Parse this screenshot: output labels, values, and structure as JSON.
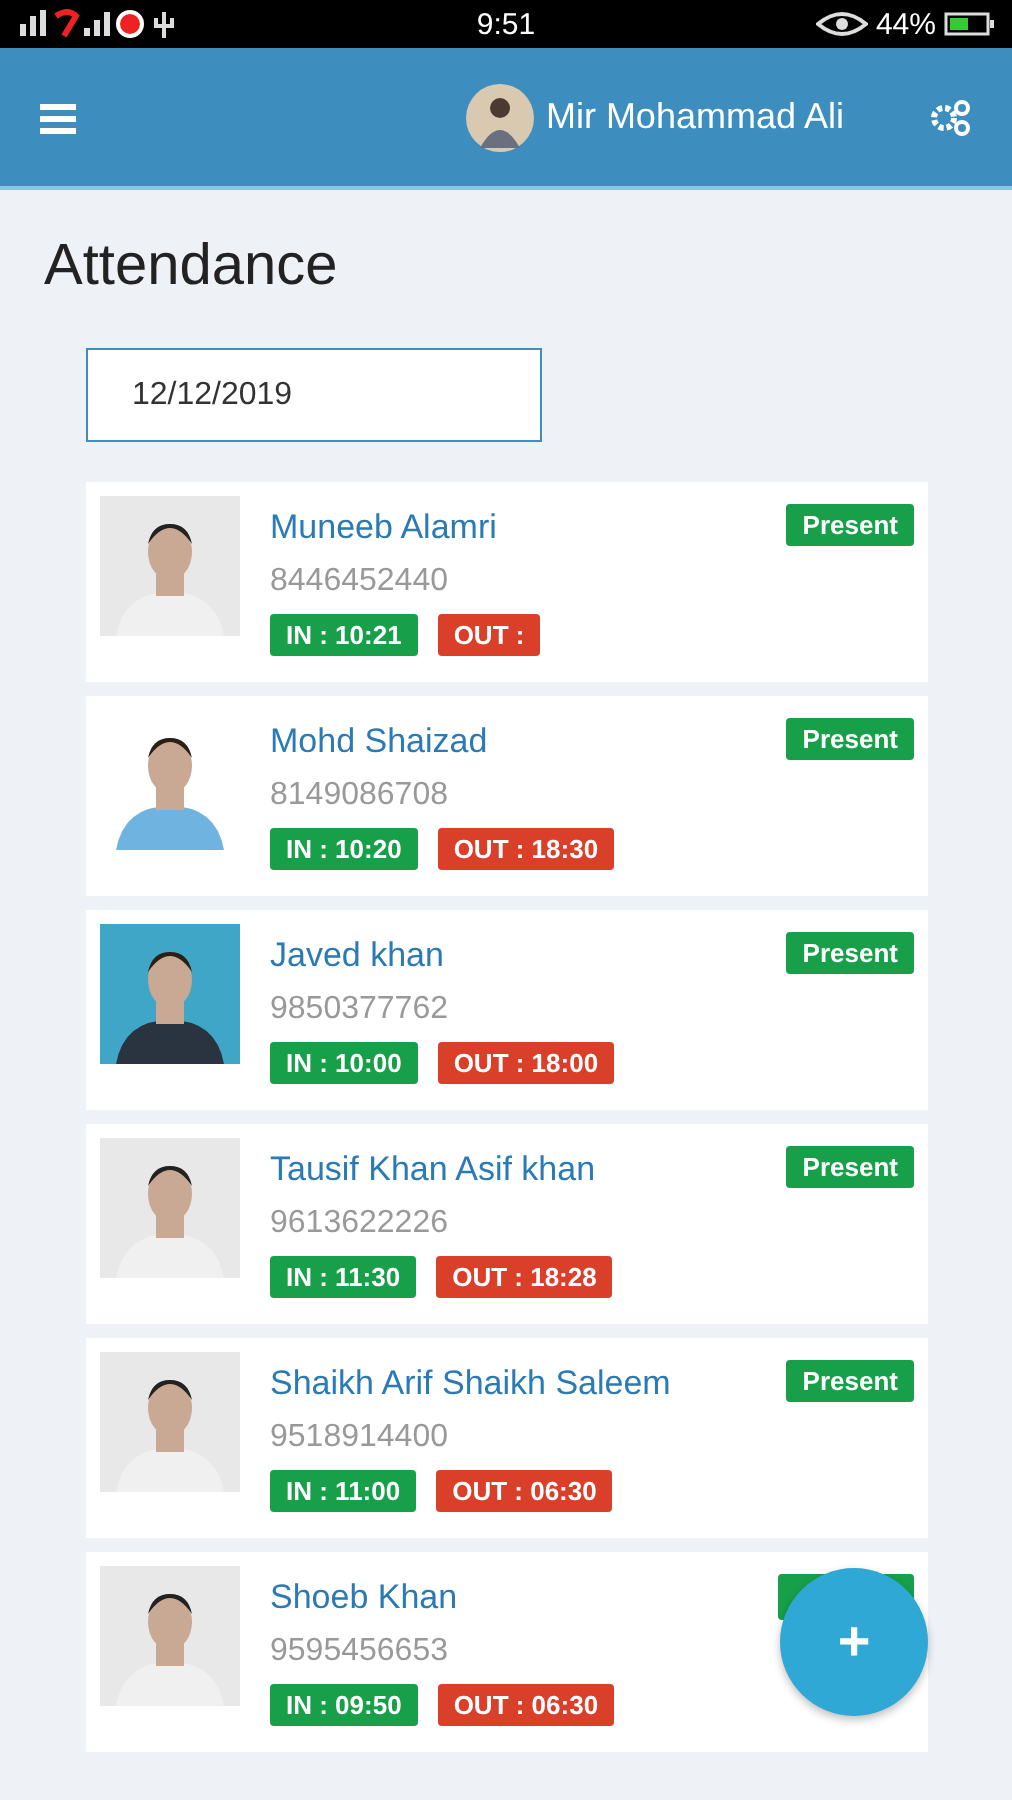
{
  "status_bar": {
    "time": "9:51",
    "battery": "44%"
  },
  "header": {
    "user_name": "Mir Mohammad Ali"
  },
  "page_title": "Attendance",
  "date_field": {
    "value": "12/12/2019"
  },
  "records": [
    {
      "name": "Muneeb Alamri",
      "phone": "8446452440",
      "status": "Present",
      "in": "IN : 10:21",
      "out": "OUT :"
    },
    {
      "name": "Mohd Shaizad",
      "phone": "8149086708",
      "status": "Present",
      "in": "IN : 10:20",
      "out": "OUT : 18:30"
    },
    {
      "name": "Javed khan",
      "phone": "9850377762",
      "status": "Present",
      "in": "IN : 10:00",
      "out": "OUT : 18:00"
    },
    {
      "name": "Tausif Khan Asif khan",
      "phone": "9613622226",
      "status": "Present",
      "in": "IN : 11:30",
      "out": "OUT : 18:28"
    },
    {
      "name": "Shaikh Arif Shaikh Saleem",
      "phone": "9518914400",
      "status": "Present",
      "in": "IN : 11:00",
      "out": "OUT : 06:30"
    },
    {
      "name": "Shoeb Khan",
      "phone": "9595456653",
      "in": "IN : 09:50",
      "out": "OUT : 06:30"
    }
  ],
  "fab": {
    "label": "+"
  }
}
